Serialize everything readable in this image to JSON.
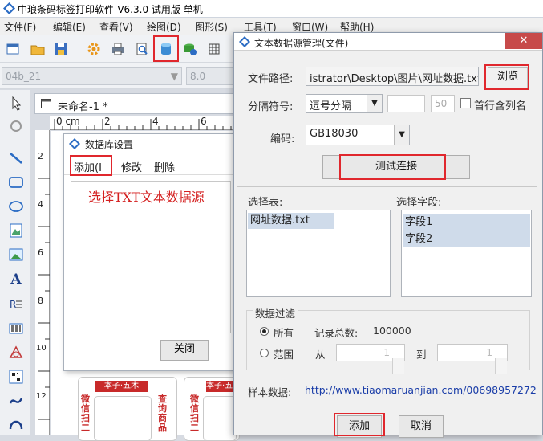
{
  "app": {
    "title": "中琅条码标签打印软件-V6.3.0 试用版 单机",
    "menu": [
      "文件(F)",
      "编辑(E)",
      "查看(V)",
      "绘图(D)",
      "图形(S)",
      "工具(T)",
      "窗口(W)",
      "帮助(H)"
    ],
    "font_combo": "04b_21",
    "size_combo": "8.0"
  },
  "document": {
    "tab_title": "未命名-1 *",
    "ruler_labels": [
      "0 cm",
      "2",
      "4",
      "6"
    ],
    "left_ruler_labels": [
      "2",
      "4",
      "6",
      "8",
      "10",
      "12"
    ],
    "label_logo": "本子·五木",
    "label_vertical_1": "微信扫二",
    "label_vertical_2": "查询商品",
    "label_vertical_3": "微信扫二"
  },
  "db_dialog": {
    "title": "数据库设置",
    "toolbar": {
      "add": "添加(I",
      "edit": "修改",
      "delete": "删除"
    },
    "annotation": "选择TXT文本数据源",
    "close_button": "关闭"
  },
  "text_dialog": {
    "title": "文本数据源管理(文件)",
    "file_path_label": "文件路径:",
    "file_path_value": "istrator\\Desktop\\图片\\网址数据.txt",
    "browse_button": "浏览",
    "separator_label": "分隔符号:",
    "separator_value": "逗号分隔",
    "separator_count": "50",
    "first_row_label": "首行含列名",
    "encoding_label": "编码:",
    "encoding_value": "GB18030",
    "test_button": "测试连接",
    "select_table_label": "选择表:",
    "tables": [
      "网址数据.txt"
    ],
    "select_field_label": "选择字段:",
    "fields": [
      "字段1",
      "字段2"
    ],
    "filter_group_label": "数据过滤",
    "all_label": "所有",
    "record_total_label": "记录总数:",
    "record_total_value": "100000",
    "range_label": "范围",
    "from_label": "从",
    "from_value": "1",
    "to_label": "到",
    "to_value": "1",
    "sample_label": "样本数据:",
    "sample_value": "http://www.tiaomaruanjian.com/00698957272",
    "add_button": "添加",
    "cancel_button": "取消"
  },
  "colors": {
    "highlight": "#e0272d",
    "selection": "#cfdbea",
    "link_blue": "#1a3da8",
    "annotation_red": "#d42020"
  }
}
